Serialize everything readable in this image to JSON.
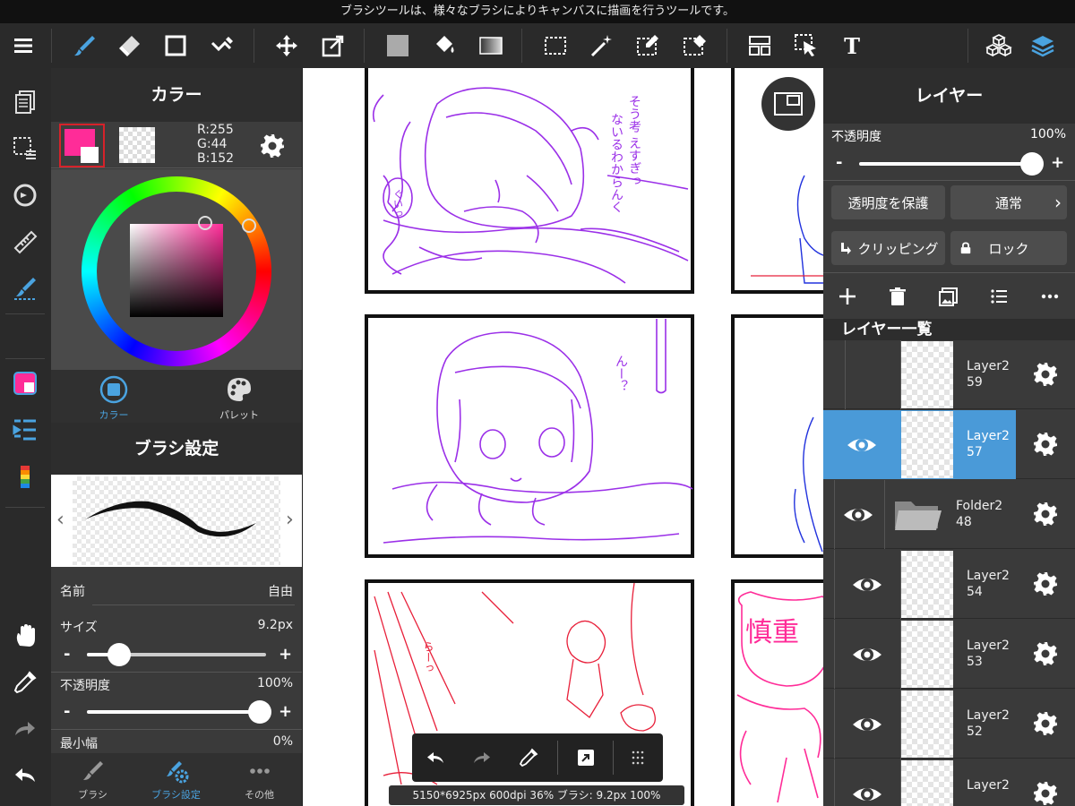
{
  "hint": "ブラシツールは、様々なブラシによりキャンバスに描画を行うツールです。",
  "colorPanel": {
    "title": "カラー",
    "r": "R:255",
    "g": "G:44",
    "b": "B:152",
    "colorHex": "#ff2c98",
    "tabs": [
      "カラー",
      "パレット"
    ]
  },
  "brushPanel": {
    "title": "ブラシ設定",
    "nameLabel": "名前",
    "nameValue": "自由",
    "sizeLabel": "サイズ",
    "sizeValue": "9.2px",
    "opacityLabel": "不透明度",
    "opacityValue": "100%",
    "minWidthLabel": "最小幅",
    "minWidthValue": "0%",
    "sizeLevel": 0.18,
    "opacityLevel": 1.0,
    "tabs": [
      "ブラシ",
      "ブラシ設定",
      "その他"
    ]
  },
  "layerPanel": {
    "title": "レイヤー",
    "opacityLabel": "不透明度",
    "opacityValue": "100%",
    "protectLabel": "透明度を保護",
    "blendLabel": "通常",
    "clippingLabel": "クリッピング",
    "lockLabel": "ロック",
    "listHeader": "レイヤー一覧",
    "layers": [
      {
        "name1": "Layer2",
        "name2": "59",
        "visible": false,
        "selected": false
      },
      {
        "name1": "Layer2",
        "name2": "57",
        "visible": true,
        "selected": true
      },
      {
        "name1": "Folder2",
        "name2": "48",
        "visible": true,
        "selected": false,
        "folder": true
      },
      {
        "name1": "Layer2",
        "name2": "54",
        "visible": true,
        "selected": false
      },
      {
        "name1": "Layer2",
        "name2": "53",
        "visible": true,
        "selected": false
      },
      {
        "name1": "Layer2",
        "name2": "52",
        "visible": true,
        "selected": false
      },
      {
        "name1": "Layer2",
        "name2": "",
        "visible": true,
        "selected": false
      }
    ]
  },
  "canvas": {
    "status": "5150*6925px 600dpi 36% ブラシ: 9.2px 100%",
    "sketchText1": "そう考 えすぎっ",
    "sketchText2": "ないるわからんく",
    "sketchText3": "ぐいっ",
    "sketchText4": "んー？",
    "sketchText5": "らーっ",
    "sketchText6": "慎重"
  },
  "colors": {
    "accent": "#4a9ad8",
    "purple": "#9b30e8",
    "pink": "#ff2c98",
    "red": "#e8203a",
    "blue": "#2233dd"
  }
}
